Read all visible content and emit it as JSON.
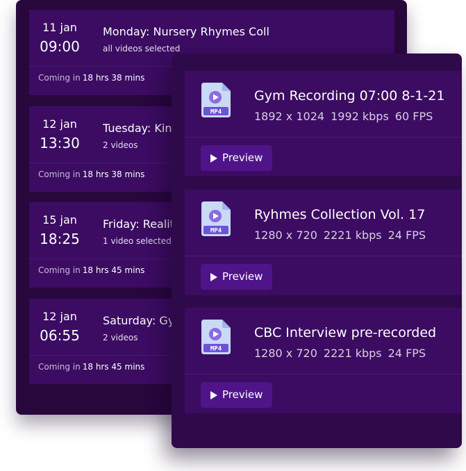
{
  "schedule": {
    "coming_in_label": "Coming in",
    "items": [
      {
        "date": "11 jan",
        "time": "09:00",
        "title": "Monday: Nursery Rhymes Collection",
        "subtitle": "all videos selected",
        "countdown": "18 hrs 38 mins"
      },
      {
        "date": "12 jan",
        "time": "13:30",
        "title": "Tuesday: Kinds",
        "subtitle": "2 videos",
        "countdown": "18 hrs 38 mins"
      },
      {
        "date": "15 jan",
        "time": "18:25",
        "title": "Friday: Reality",
        "subtitle": "1 video selected",
        "countdown": "18 hrs 45 mins"
      },
      {
        "date": "12 jan",
        "time": "06:55",
        "title": "Saturday: Gym",
        "subtitle": "2 videos",
        "countdown": "18 hrs 45 mins"
      }
    ]
  },
  "media": {
    "file_type_label": "MP4",
    "preview_label": "Preview",
    "files": [
      {
        "name": "Gym Recording 07:00 8-1-21",
        "resolution": "1892 x 1024",
        "bitrate": "1992 kbps",
        "fps": "60 FPS"
      },
      {
        "name": "Ryhmes Collection Vol. 17",
        "resolution": "1280 x 720",
        "bitrate": "2221 kbps",
        "fps": "24 FPS"
      },
      {
        "name": "CBC Interview pre-recorded",
        "resolution": "1280 x 720",
        "bitrate": "2221 kbps",
        "fps": "24 FPS"
      }
    ]
  },
  "colors": {
    "panel_back": "#28073d",
    "panel_front": "#2f0a4a",
    "card": "#3b0c62",
    "button": "#4f1489",
    "icon_accent": "#8b6be0"
  },
  "icons": {
    "file": "mp4-file-icon",
    "play": "play-icon"
  }
}
